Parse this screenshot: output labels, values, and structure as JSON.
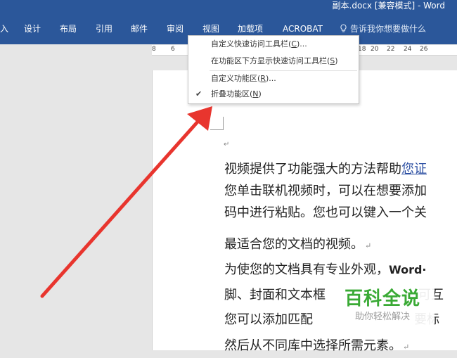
{
  "window": {
    "title": "副本.docx [兼容模式]  -  Word"
  },
  "ribbon": {
    "tabs": [
      {
        "label": "入"
      },
      {
        "label": "设计"
      },
      {
        "label": "布局"
      },
      {
        "label": "引用"
      },
      {
        "label": "邮件"
      },
      {
        "label": "审阅"
      },
      {
        "label": "视图"
      },
      {
        "label": "加载项"
      },
      {
        "label": "ACROBAT"
      }
    ],
    "tell_me": "告诉我你想要做什么",
    "tell_me_icon": "lightbulb-icon",
    "accent": "#2b579a"
  },
  "ruler": {
    "numbers": [
      "8",
      "6",
      "18",
      "20",
      "22",
      "24",
      "26"
    ],
    "left_label": "8 6"
  },
  "context_menu": {
    "items": [
      {
        "label": "自定义快速访问工具栏",
        "accel": "C",
        "suffix": "..."
      },
      {
        "label": "在功能区下方显示快速访问工具栏",
        "accel": "S",
        "suffix": ""
      },
      {
        "label": "自定义功能区",
        "accel": "R",
        "suffix": "..."
      },
      {
        "label": "折叠功能区",
        "accel": "N",
        "suffix": "",
        "checked": true
      }
    ],
    "check_icon": "checkmark-icon"
  },
  "document": {
    "lines": [
      {
        "pre": "视频提供了功能强大的方法帮助",
        "link": "您证"
      },
      {
        "text": "您单击联机视频时，可以在想要添加"
      },
      {
        "text": "码中进行粘贴。您也可以键入一个关"
      },
      {
        "text": "最适合您的文档的视频。"
      },
      {
        "pre": "为使您的文档具有专业外观，",
        "bold": "Word·"
      },
      {
        "text": "脚、封面和文本框",
        "tail": "可互"
      },
      {
        "text": "您可以添加匹配",
        "tail": "要标"
      },
      {
        "text": "然后从不同库中选择所需元素。"
      }
    ],
    "paragraph_mark": "↵"
  },
  "annotation": {
    "arrow_color": "#e8352e",
    "arrow_icon": "red-arrow-icon"
  },
  "watermark": {
    "title": "百科全说",
    "subtitle": "助你轻松解决",
    "color": "#3aaa35"
  }
}
